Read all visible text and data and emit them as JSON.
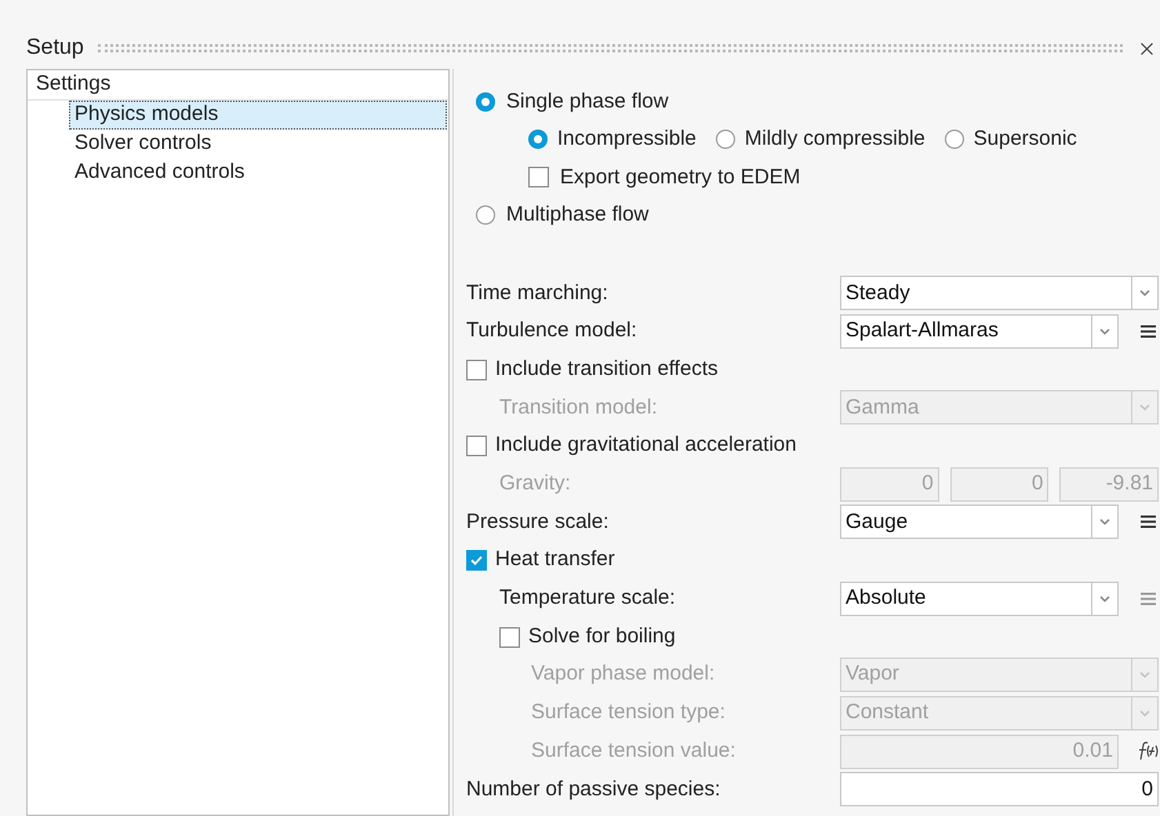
{
  "window": {
    "title": "Setup"
  },
  "sidebar": {
    "header": "Settings",
    "items": [
      {
        "label": "Physics models",
        "selected": true
      },
      {
        "label": "Solver controls",
        "selected": false
      },
      {
        "label": "Advanced controls",
        "selected": false
      }
    ]
  },
  "flow": {
    "options": [
      {
        "label": "Single phase flow",
        "selected": true,
        "children": [
          {
            "label": "Incompressible",
            "selected": true
          },
          {
            "label": "Mildly compressible",
            "selected": false
          },
          {
            "label": "Supersonic",
            "selected": false
          }
        ],
        "checkbox": {
          "label": "Export geometry to EDEM",
          "checked": false
        }
      },
      {
        "label": "Multiphase flow",
        "selected": false
      }
    ]
  },
  "rows": [
    {
      "kind": "select",
      "label": "Time marching:",
      "value": "Steady",
      "disabled": false,
      "menu": false
    },
    {
      "kind": "select",
      "label": "Turbulence model:",
      "value": "Spalart-Allmaras",
      "disabled": false,
      "menu": true
    },
    {
      "kind": "checkbox",
      "label": "Include transition effects",
      "checked": false,
      "children": [
        {
          "kind": "select",
          "label": "Transition model:",
          "value": "Gamma",
          "disabled": true,
          "menu": false
        }
      ]
    },
    {
      "kind": "checkbox",
      "label": "Include gravitational acceleration",
      "checked": false,
      "children": [
        {
          "kind": "vector",
          "label": "Gravity:",
          "values": [
            "0",
            "0",
            "-9.81"
          ],
          "disabled": true
        }
      ]
    },
    {
      "kind": "select",
      "label": "Pressure scale:",
      "value": "Gauge",
      "disabled": false,
      "menu": true
    },
    {
      "kind": "checkbox",
      "label": "Heat transfer",
      "checked": true,
      "children": [
        {
          "kind": "select",
          "label": "Temperature scale:",
          "value": "Absolute",
          "disabled": false,
          "menu": true
        },
        {
          "kind": "checkbox",
          "label": "Solve for boiling",
          "checked": false,
          "children": [
            {
              "kind": "select",
              "label": "Vapor phase model:",
              "value": "Vapor",
              "disabled": true,
              "menu": false
            },
            {
              "kind": "select",
              "label": "Surface tension type:",
              "value": "Constant",
              "disabled": true,
              "menu": false
            },
            {
              "kind": "function",
              "label": "Surface tension value:",
              "value": "0.01",
              "disabled": true
            }
          ]
        }
      ]
    },
    {
      "kind": "number",
      "label": "Number of passive species:",
      "value": "0",
      "disabled": false
    }
  ]
}
